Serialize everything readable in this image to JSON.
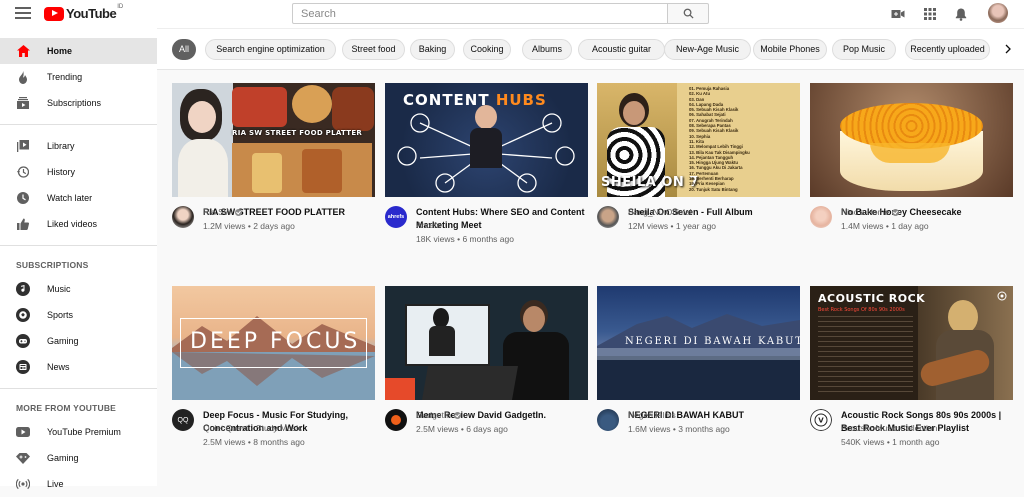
{
  "header": {
    "logo_text": "YouTube",
    "logo_country": "ID",
    "search_placeholder": "Search"
  },
  "sidebar": {
    "main": [
      {
        "label": "Home",
        "icon": "home-icon",
        "active": true
      },
      {
        "label": "Trending",
        "icon": "trending-icon"
      },
      {
        "label": "Subscriptions",
        "icon": "subscriptions-icon"
      }
    ],
    "library": [
      {
        "label": "Library",
        "icon": "library-icon"
      },
      {
        "label": "History",
        "icon": "history-icon"
      },
      {
        "label": "Watch later",
        "icon": "watch-later-icon"
      },
      {
        "label": "Liked videos",
        "icon": "liked-videos-icon"
      }
    ],
    "subscriptions_heading": "SUBSCRIPTIONS",
    "subscriptions": [
      {
        "label": "Music",
        "icon": "music-icon"
      },
      {
        "label": "Sports",
        "icon": "sports-icon"
      },
      {
        "label": "Gaming",
        "icon": "gaming-icon"
      },
      {
        "label": "News",
        "icon": "news-icon"
      }
    ],
    "more_heading": "MORE FROM YOUTUBE",
    "more": [
      {
        "label": "YouTube Premium",
        "icon": "youtube-premium-icon"
      },
      {
        "label": "Gaming",
        "icon": "gaming-icon"
      },
      {
        "label": "Live",
        "icon": "live-icon"
      }
    ]
  },
  "chips": [
    "All",
    "Search engine optimization",
    "Street food",
    "Baking",
    "Cooking",
    "Albums",
    "Acoustic guitar",
    "New-Age Music",
    "Mobile Phones",
    "Pop Music",
    "Recently uploaded"
  ],
  "videos": [
    {
      "title": "RIA SW STREET FOOD PLATTER",
      "channel": "Ria SW",
      "verified": true,
      "views": "1.2M views",
      "age": "2 days ago",
      "thumb_text": "RIA SW STREET FOOD PLATTER"
    },
    {
      "title": "Content Hubs: Where SEO and Content Marketing Meet",
      "channel": "Ahrefs",
      "verified": false,
      "views": "18K views",
      "age": "6 months ago",
      "thumb_text_a": "CONTENT",
      "thumb_text_b": "HUBS",
      "avatar_text": "ahrefs"
    },
    {
      "title": "Sheila On Seven - Full Album",
      "channel": "Bang_Nu Official",
      "verified": false,
      "views": "12M views",
      "age": "1 year ago",
      "thumb_text": "SHEILA ON 7"
    },
    {
      "title": "No Bake Honey Cheesecake",
      "channel": "Nino's Home",
      "verified": true,
      "views": "1.4M views",
      "age": "1 day ago"
    },
    {
      "title": "Deep Focus - Music For Studying, Concentration and Work",
      "channel": "Quiet Quest - Study Music",
      "verified": false,
      "views": "2.5M views",
      "age": "8 months ago",
      "thumb_text": "DEEP FOCUS",
      "avatar_text": "QQ"
    },
    {
      "title": "Meme Review David GadgetIn.",
      "channel": "GadgetIn",
      "verified": true,
      "views": "2.5M views",
      "age": "6 days ago"
    },
    {
      "title": "NEGERI DI BAWAH KABUT",
      "channel": "Negeri Films",
      "verified": false,
      "views": "1.6M views",
      "age": "3 months ago",
      "thumb_text": "NEGERI DI BAWAH KABUT"
    },
    {
      "title": "Acoustic Rock Songs 80s 90s 2000s | Best Rock Music Ever Playlist",
      "channel": "Acoustic Music Collection",
      "verified": false,
      "views": "540K views",
      "age": "1 month ago",
      "thumb_text_a": "ACOUSTIC ROCK",
      "thumb_text_b": "Best Rock Songs Of 80s 90s 2000s"
    }
  ],
  "sheila_tracklist": [
    "01. Pemuja Rahasia",
    "02. Ku Atu",
    "03. Dan",
    "04. Lapang Dada",
    "05. Sebuah Kisah Klasik",
    "06. Sahabat Sejati",
    "07. Anugrah Terindah",
    "08. Seberapa Pantas",
    "09. Sebuah Kisah Klasik",
    "10. Sephia",
    "11. Kita",
    "12. Melompat Lebih Tinggi",
    "13. Bila Kau Tak Disampingku",
    "14. Pejantan Tangguh",
    "15. Hingga Ujung Waktu",
    "16. Tunggu Aku Di Jakarta",
    "17. Pertemuan",
    "18. Berhenti Berharap",
    "19. Pria Kesepian",
    "20. Tunjuk Satu Bintang"
  ],
  "colors": {
    "accent_red": "#ff0000",
    "chip_active": "#606060"
  }
}
